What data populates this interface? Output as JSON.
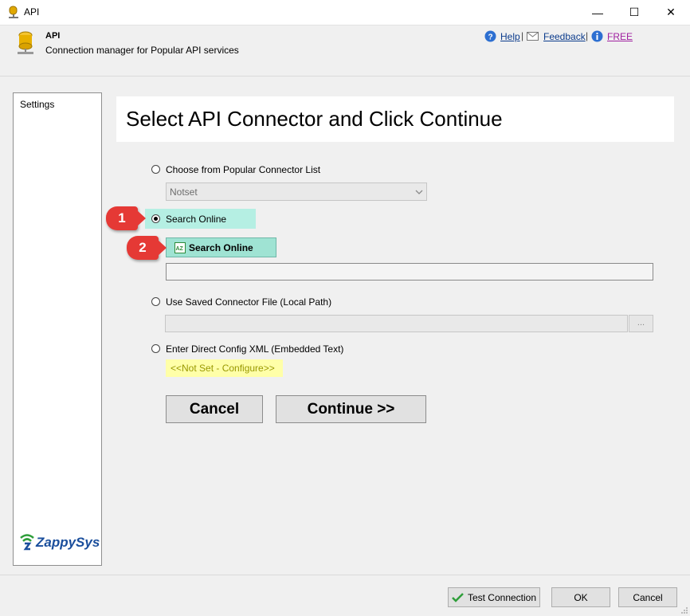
{
  "window": {
    "title": "API",
    "minimize_glyph": "—",
    "maximize_glyph": "☐",
    "close_glyph": "✕"
  },
  "header": {
    "title": "API",
    "subtitle": "Connection manager for Popular API services",
    "links": {
      "help": "Help",
      "feedback": "Feedback",
      "free": "FREE"
    },
    "separator": "|"
  },
  "sidebar": {
    "items": [
      {
        "label": "Settings"
      }
    ],
    "logo_text": "ZappySys"
  },
  "main": {
    "heading": "Select API Connector and Click Continue",
    "options": {
      "popular": {
        "label": "Choose from Popular Connector List",
        "checked": false,
        "dropdown_value": "Notset"
      },
      "search": {
        "label": "Search Online",
        "checked": true,
        "button_label": "Search Online",
        "input_value": ""
      },
      "saved": {
        "label": "Use Saved Connector File (Local Path)",
        "checked": false,
        "path_value": "",
        "browse_label": "..."
      },
      "xml": {
        "label": "Enter Direct Config XML (Embedded Text)",
        "checked": false,
        "link_label": "<<Not Set - Configure>>"
      }
    },
    "buttons": {
      "cancel": "Cancel",
      "continue": "Continue >>"
    }
  },
  "annotations": {
    "badge1": "1",
    "badge2": "2"
  },
  "footer": {
    "test_connection": "Test Connection",
    "ok": "OK",
    "cancel": "Cancel"
  },
  "colors": {
    "highlight": "#b5efe3",
    "search_button": "#9fe3d3",
    "xml_link_bg": "#ffffa8",
    "badge": "#e53935",
    "free_link": "#a020a0"
  }
}
